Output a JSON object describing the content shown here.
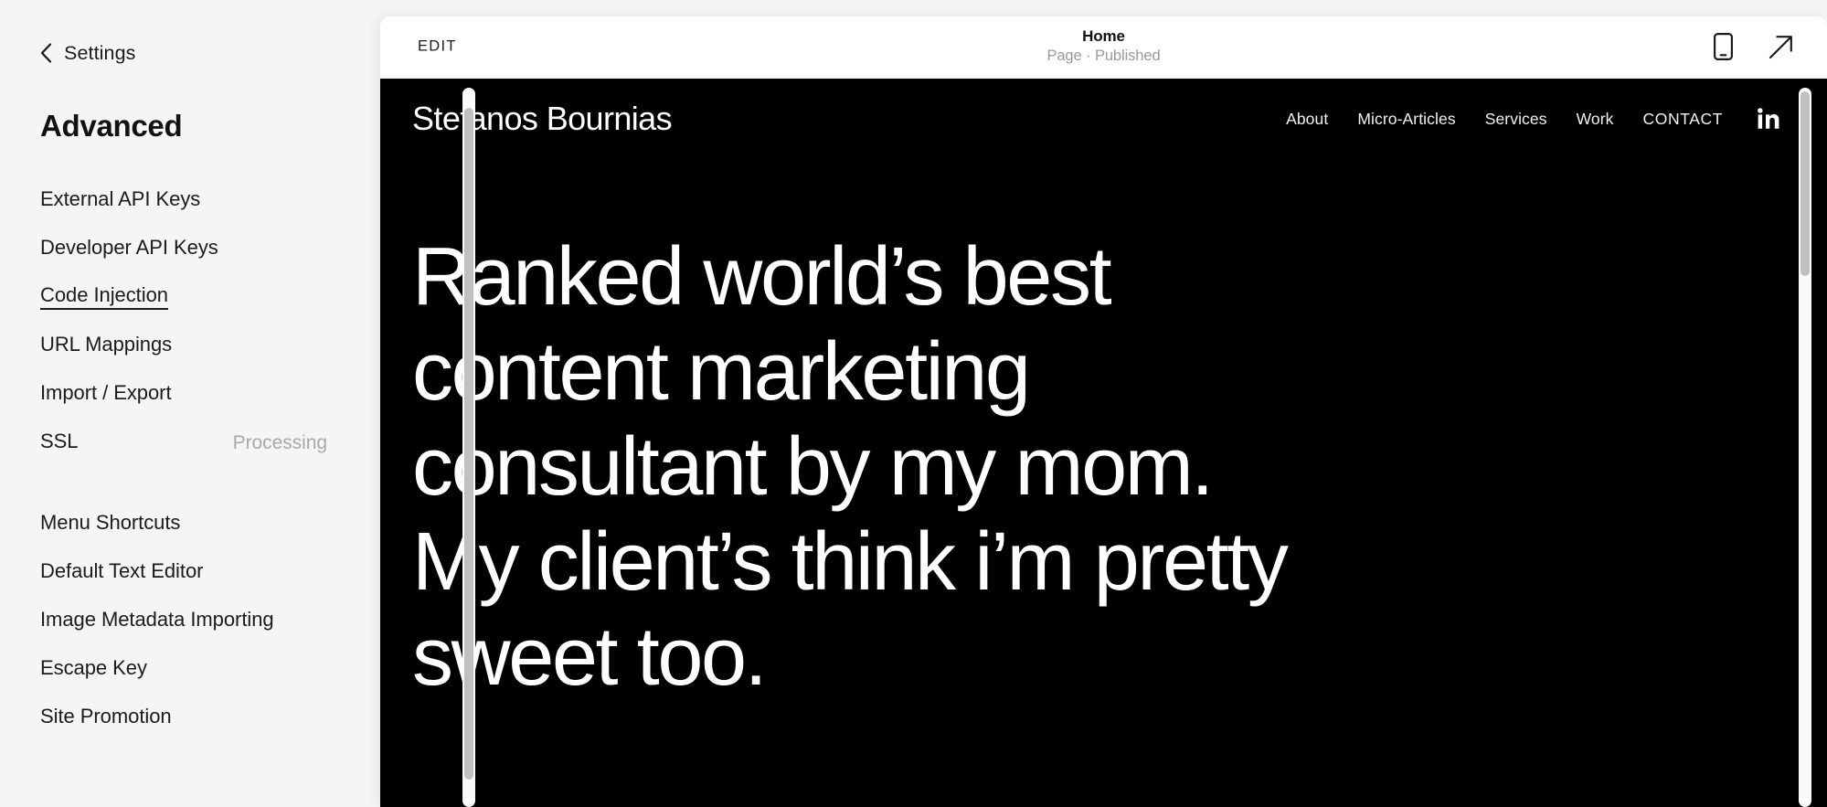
{
  "sidebar": {
    "back": {
      "label": "Settings",
      "icon": "chevron-left-icon"
    },
    "title": "Advanced",
    "groups": [
      {
        "items": [
          {
            "label": "External API Keys",
            "status": "",
            "active": false
          },
          {
            "label": "Developer API Keys",
            "status": "",
            "active": false
          },
          {
            "label": "Code Injection",
            "status": "",
            "active": true
          },
          {
            "label": "URL Mappings",
            "status": "",
            "active": false
          },
          {
            "label": "Import / Export",
            "status": "",
            "active": false
          },
          {
            "label": "SSL",
            "status": "Processing",
            "active": false
          }
        ]
      },
      {
        "items": [
          {
            "label": "Menu Shortcuts",
            "status": "",
            "active": false
          },
          {
            "label": "Default Text Editor",
            "status": "",
            "active": false
          },
          {
            "label": "Image Metadata Importing",
            "status": "",
            "active": false
          },
          {
            "label": "Escape Key",
            "status": "",
            "active": false
          },
          {
            "label": "Site Promotion",
            "status": "",
            "active": false
          }
        ]
      }
    ]
  },
  "preview": {
    "header": {
      "edit_label": "EDIT",
      "title": "Home",
      "subtitle": "Page · Published",
      "actions": [
        {
          "name": "mobile-view-icon"
        },
        {
          "name": "open-external-icon"
        }
      ]
    },
    "site": {
      "brand": "Stefanos Bournias",
      "menu": [
        {
          "label": "About"
        },
        {
          "label": "Micro-Articles"
        },
        {
          "label": "Services"
        },
        {
          "label": "Work"
        },
        {
          "label": "CONTACT"
        }
      ],
      "social_icon": "linkedin-icon",
      "headline": "Ranked world’s best content marketing consultant by my mom. My client’s think i’m pretty sweet too."
    }
  },
  "colors": {
    "app_background": "#f5f5f5",
    "panel_background": "#ffffff",
    "site_background": "#000000",
    "text_primary": "#1b1b1b",
    "text_muted": "#a8a8a8",
    "site_text": "#ffffff",
    "scrollbar_thumb": "#c0c0c0"
  }
}
